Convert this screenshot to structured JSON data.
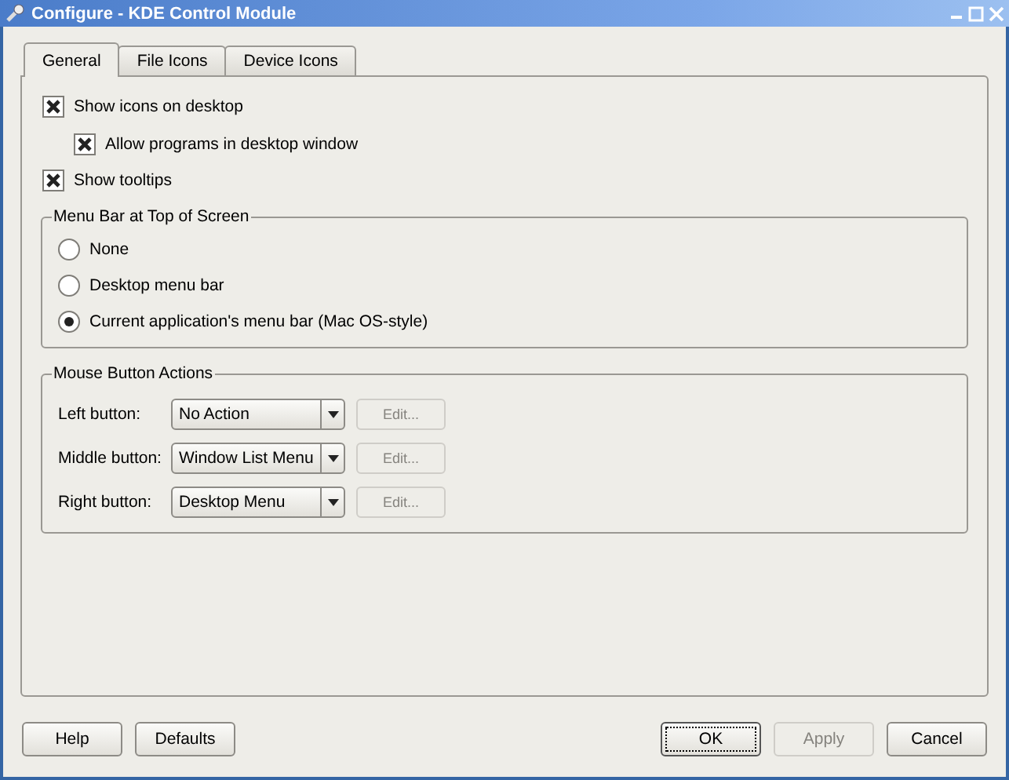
{
  "window": {
    "title": "Configure - KDE Control Module"
  },
  "tabs": [
    {
      "label": "General",
      "selected": true
    },
    {
      "label": "File Icons",
      "selected": false
    },
    {
      "label": "Device Icons",
      "selected": false
    }
  ],
  "options": [
    {
      "label": "Show icons on desktop",
      "checked": true,
      "children": [
        {
          "label": "Allow programs in desktop window",
          "checked": true
        }
      ]
    },
    {
      "label": "Show tooltips",
      "checked": true
    }
  ],
  "menu_bar_group": {
    "title": "Menu Bar at Top of Screen",
    "choices": [
      {
        "label": "None",
        "selected": false
      },
      {
        "label": "Desktop menu bar",
        "selected": false
      },
      {
        "label": "Current application's menu bar (Mac OS-style)",
        "selected": true
      }
    ]
  },
  "mouse_group": {
    "title": "Mouse Button Actions",
    "rows": [
      {
        "label": "Left button:",
        "value": "No Action",
        "edit": {
          "label": "Edit...",
          "disabled": true
        }
      },
      {
        "label": "Middle button:",
        "value": "Window List Menu",
        "edit": {
          "label": "Edit...",
          "disabled": true
        }
      },
      {
        "label": "Right button:",
        "value": "Desktop Menu",
        "edit": {
          "label": "Edit...",
          "disabled": true
        }
      }
    ]
  },
  "buttons_left": [
    {
      "label": "Help",
      "disabled": false,
      "focused": false
    },
    {
      "label": "Defaults",
      "disabled": false,
      "focused": false
    }
  ],
  "buttons_right": [
    {
      "label": "OK",
      "disabled": false,
      "focused": true
    },
    {
      "label": "Apply",
      "disabled": true,
      "focused": false
    },
    {
      "label": "Cancel",
      "disabled": false,
      "focused": false
    }
  ]
}
